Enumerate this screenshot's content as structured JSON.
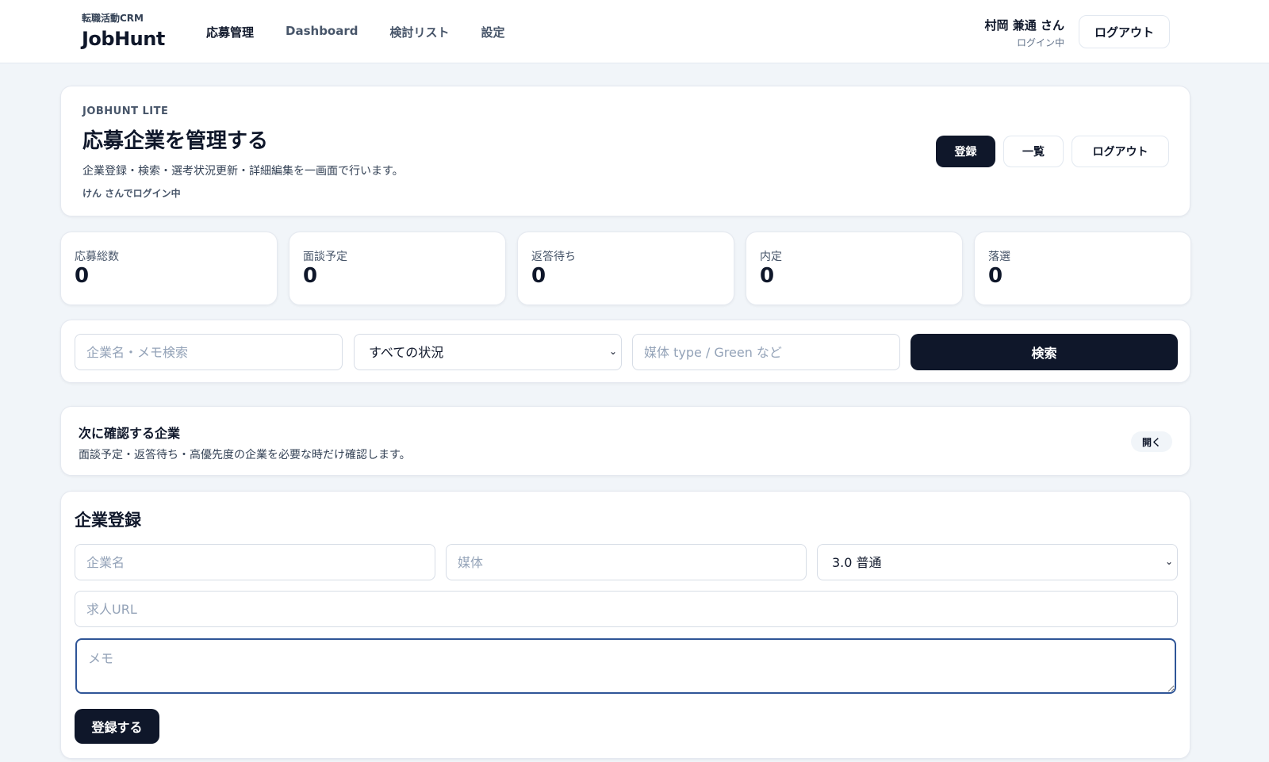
{
  "header": {
    "brand_sub": "転職活動CRM",
    "brand_name": "JobHunt",
    "nav": [
      "応募管理",
      "Dashboard",
      "検討リスト",
      "設定"
    ],
    "user_name": "村岡 兼通 さん",
    "user_status": "ログイン中",
    "logout_label": "ログアウト"
  },
  "hero": {
    "eyebrow": "JOBHUNT LITE",
    "title": "応募企業を管理する",
    "description": "企業登録・検索・選考状況更新・詳細編集を一画面で行います。",
    "login_note": "けん さんでログイン中",
    "actions": {
      "register": "登録",
      "list": "一覧",
      "logout": "ログアウト"
    }
  },
  "stats": [
    {
      "label": "応募総数",
      "value": "0"
    },
    {
      "label": "面談予定",
      "value": "0"
    },
    {
      "label": "返答待ち",
      "value": "0"
    },
    {
      "label": "内定",
      "value": "0"
    },
    {
      "label": "落選",
      "value": "0"
    }
  ],
  "search": {
    "keyword_placeholder": "企業名・メモ検索",
    "status_selected": "すべての状況",
    "media_placeholder": "媒体 type / Green など",
    "button_label": "検索"
  },
  "next_check": {
    "title": "次に確認する企業",
    "description": "面談予定・返答待ち・高優先度の企業を必要な時だけ確認します。",
    "open_label": "開く"
  },
  "register": {
    "title": "企業登録",
    "company_placeholder": "企業名",
    "media_placeholder": "媒体",
    "priority_selected": "3.0 普通",
    "url_placeholder": "求人URL",
    "memo_placeholder": "メモ",
    "submit_label": "登録する"
  },
  "icons": {
    "select_arrow": "chevron-down-icon"
  },
  "colors": {
    "primary": "#0f172a",
    "background": "#f1f5f9",
    "focus": "#2f5597"
  }
}
